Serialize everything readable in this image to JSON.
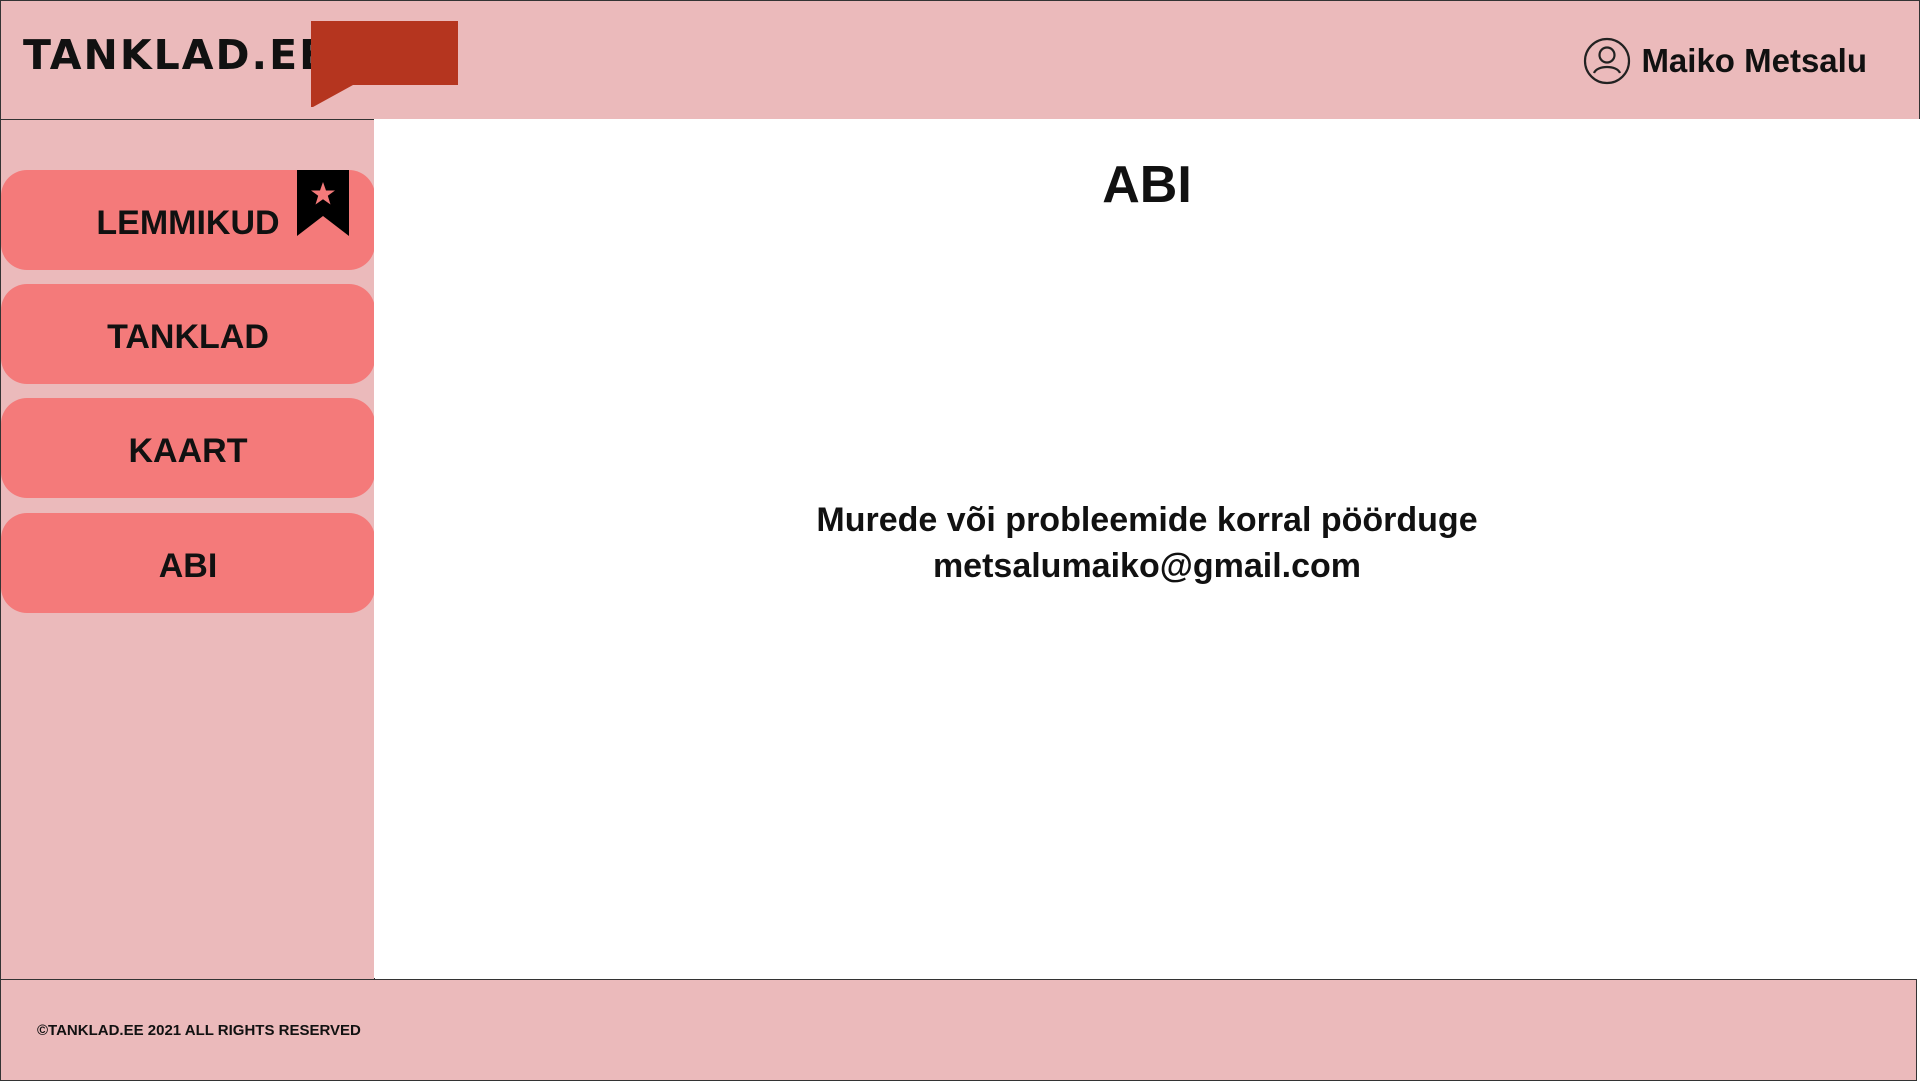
{
  "header": {
    "logo_text": "TANKLAD.EE",
    "logo_flag_color": "#b5351f",
    "user_name": "Maiko Metsalu",
    "user_icon": "user-circle-icon"
  },
  "sidebar": {
    "items": [
      {
        "label": "LEMMIKUD",
        "icon": "bookmark-star-icon"
      },
      {
        "label": "TANKLAD"
      },
      {
        "label": "KAART"
      },
      {
        "label": "ABI"
      }
    ]
  },
  "main": {
    "title": "ABI",
    "help_line1": "Murede või probleemide korral pöörduge",
    "help_line2": "metsalumaiko@gmail.com"
  },
  "footer": {
    "copyright": "©TANKLAD.EE 2021 ALL RIGHTS RESERVED"
  },
  "colors": {
    "panel_bg": "#ebbabb",
    "button_bg": "#f47a7a",
    "accent": "#b5351f"
  }
}
